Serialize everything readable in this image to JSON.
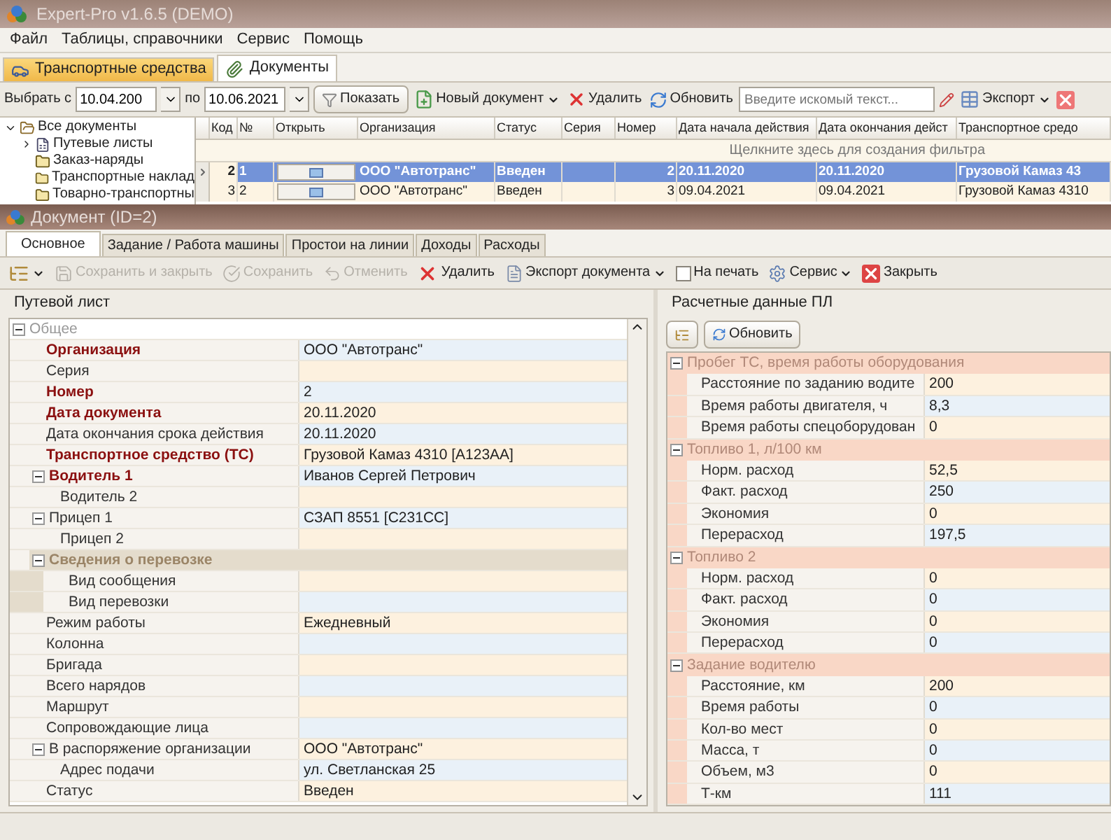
{
  "window": {
    "title": "Expert-Pro v1.6.5 (DEMO)"
  },
  "menu": [
    "Файл",
    "Таблицы, справочники",
    "Сервис",
    "Помощь"
  ],
  "tabs": [
    {
      "label": "Транспортные средства",
      "kind": "vehicles",
      "selected": false
    },
    {
      "label": "Документы",
      "kind": "documents",
      "selected": true
    }
  ],
  "toolbar": {
    "from_label": "Выбрать с",
    "from_date": "10.04.200",
    "to_label": "по",
    "to_date": "10.06.2021",
    "show": "Показать",
    "new_doc": "Новый документ",
    "delete": "Удалить",
    "refresh": "Обновить",
    "search": {
      "placeholder": "Введите искомый текст..."
    },
    "export": "Экспорт"
  },
  "tree": [
    {
      "label": "Все документы",
      "expanded": true,
      "children": [
        {
          "label": "Путевые листы",
          "kind": "waybills"
        },
        {
          "label": "Заказ-наряды",
          "kind": "folder"
        },
        {
          "label": "Транспортные наклад",
          "kind": "folder"
        },
        {
          "label": "Товарно-транспортны",
          "kind": "folder"
        }
      ]
    }
  ],
  "grid": {
    "columns": [
      "Код",
      "№",
      "Открыть",
      "Организация",
      "Статус",
      "Серия",
      "Номер",
      "Дата начала действия",
      "Дата окончания дейст",
      "Транспортное средо"
    ],
    "filter_hint": "Щелкните здесь для создания фильтра",
    "rows": [
      {
        "selected": true,
        "code": "2",
        "no": "1",
        "organization": "ООО \"Автотранс\"",
        "status": "Введен",
        "number": "2",
        "start_date": "20.11.2020",
        "end_date": "20.11.2020",
        "vehicle": "Грузовой Камаз 43"
      },
      {
        "selected": false,
        "code": "3",
        "no": "2",
        "organization": "ООО \"Автотранс\"",
        "status": "Введен",
        "number": "3",
        "start_date": "09.04.2021",
        "end_date": "09.04.2021",
        "vehicle": "Грузовой Камаз 4310"
      }
    ]
  },
  "document": {
    "title": "Документ (ID=2)",
    "tabs": [
      {
        "label": "Основное",
        "selected": true
      },
      {
        "label": "Задание / Работа машины",
        "selected": false
      },
      {
        "label": "Простои на линии",
        "selected": false
      },
      {
        "label": "Доходы",
        "selected": false
      },
      {
        "label": "Расходы",
        "selected": false
      }
    ],
    "toolbar": [
      {
        "kind": "save_close",
        "label": "Сохранить и закрыть",
        "disabled": true
      },
      {
        "kind": "save",
        "label": "Сохранить",
        "disabled": true
      },
      {
        "kind": "undo",
        "label": "Отменить",
        "disabled": true
      },
      {
        "kind": "delete",
        "label": "Удалить",
        "disabled": false
      },
      {
        "kind": "export",
        "label": "Экспорт документа",
        "disabled": false
      },
      {
        "kind": "checkbox",
        "label": "На печать",
        "checked": false
      },
      {
        "kind": "service",
        "label": "Сервис",
        "disabled": false
      },
      {
        "kind": "close",
        "label": "Закрыть",
        "disabled": false
      }
    ],
    "left": {
      "title": "Путевой лист",
      "items": [
        {
          "kind": "group",
          "label": "Общее",
          "expanded": true,
          "children": [
            {
              "kind": "field",
              "label": "Организация",
              "required": true,
              "value": "ООО \"Автотранс\""
            },
            {
              "kind": "field",
              "label": "Серия",
              "required": false
            },
            {
              "kind": "field",
              "label": "Номер",
              "required": true,
              "value": "2"
            },
            {
              "kind": "field",
              "label": "Дата документа",
              "required": true,
              "value": "20.11.2020"
            },
            {
              "kind": "field",
              "label": "Дата окончания срока действия",
              "required": false,
              "value": "20.11.2020"
            },
            {
              "kind": "field",
              "label": "Транспортное средство (ТС)",
              "required": true,
              "value": "Грузовой Камаз 4310 [А123АА]"
            },
            {
              "kind": "field",
              "label": "Водитель 1",
              "required": true,
              "value": "Иванов Сергей Петрович",
              "expanded": true,
              "children": [
                {
                  "kind": "field",
                  "label": "Водитель 2",
                  "required": false
                }
              ]
            },
            {
              "kind": "field",
              "label": "Прицеп 1",
              "required": false,
              "value": "СЗАП 8551 [С231СС]",
              "expanded": true,
              "children": [
                {
                  "kind": "field",
                  "label": "Прицеп 2",
                  "required": false
                }
              ]
            },
            {
              "kind": "section",
              "label": "Сведения о перевозке",
              "expanded": true,
              "children": [
                {
                  "kind": "field",
                  "label": "Вид сообщения",
                  "required": false
                },
                {
                  "kind": "field",
                  "label": "Вид перевозки",
                  "required": false
                }
              ]
            },
            {
              "kind": "field",
              "label": "Режим работы",
              "required": false,
              "value": "Ежедневный"
            },
            {
              "kind": "field",
              "label": "Колонна",
              "required": false
            },
            {
              "kind": "field",
              "label": "Бригада",
              "required": false
            },
            {
              "kind": "field",
              "label": "Всего нарядов",
              "required": false
            },
            {
              "kind": "field",
              "label": "Маршрут",
              "required": false
            },
            {
              "kind": "field",
              "label": "Сопровождающие лица",
              "required": false
            },
            {
              "kind": "field",
              "label": "В распоряжение организации",
              "required": false,
              "value": "ООО \"Автотранс\"",
              "expanded": true,
              "children": [
                {
                  "kind": "field",
                  "label": "Адрес подачи",
                  "required": false,
                  "value": "ул. Светланская 25"
                }
              ]
            },
            {
              "kind": "field",
              "label": "Статус",
              "required": false,
              "value": "Введен"
            }
          ]
        }
      ]
    },
    "right": {
      "title": "Расчетные данные ПЛ",
      "refresh": "Обновить",
      "groups": [
        {
          "label": "Пробег ТС, время работы оборудования",
          "expanded": true,
          "rows": [
            {
              "label": "Расстояние по заданию водите",
              "value": "200"
            },
            {
              "label": "Время работы двигателя, ч",
              "value": "8,3"
            },
            {
              "label": "Время работы спецоборудован",
              "value": "0"
            }
          ]
        },
        {
          "label": "Топливо 1, л/100 км",
          "expanded": true,
          "rows": [
            {
              "label": "Норм. расход",
              "value": "52,5"
            },
            {
              "label": "Факт. расход",
              "value": "250"
            },
            {
              "label": "Экономия",
              "value": "0"
            },
            {
              "label": "Перерасход",
              "value": "197,5"
            }
          ]
        },
        {
          "label": "Топливо 2",
          "expanded": true,
          "rows": [
            {
              "label": "Норм. расход",
              "value": "0"
            },
            {
              "label": "Факт. расход",
              "value": "0"
            },
            {
              "label": "Экономия",
              "value": "0"
            },
            {
              "label": "Перерасход",
              "value": "0"
            }
          ]
        },
        {
          "label": "Задание водителю",
          "expanded": true,
          "rows": [
            {
              "label": "Расстояние, км",
              "value": "200"
            },
            {
              "label": "Время работы",
              "value": "0"
            },
            {
              "label": "Кол-во мест",
              "value": "0"
            },
            {
              "label": "Масса, т",
              "value": "0"
            },
            {
              "label": "Объем, м3",
              "value": "0"
            },
            {
              "label": "Т-км",
              "value": "111"
            }
          ]
        }
      ]
    }
  }
}
